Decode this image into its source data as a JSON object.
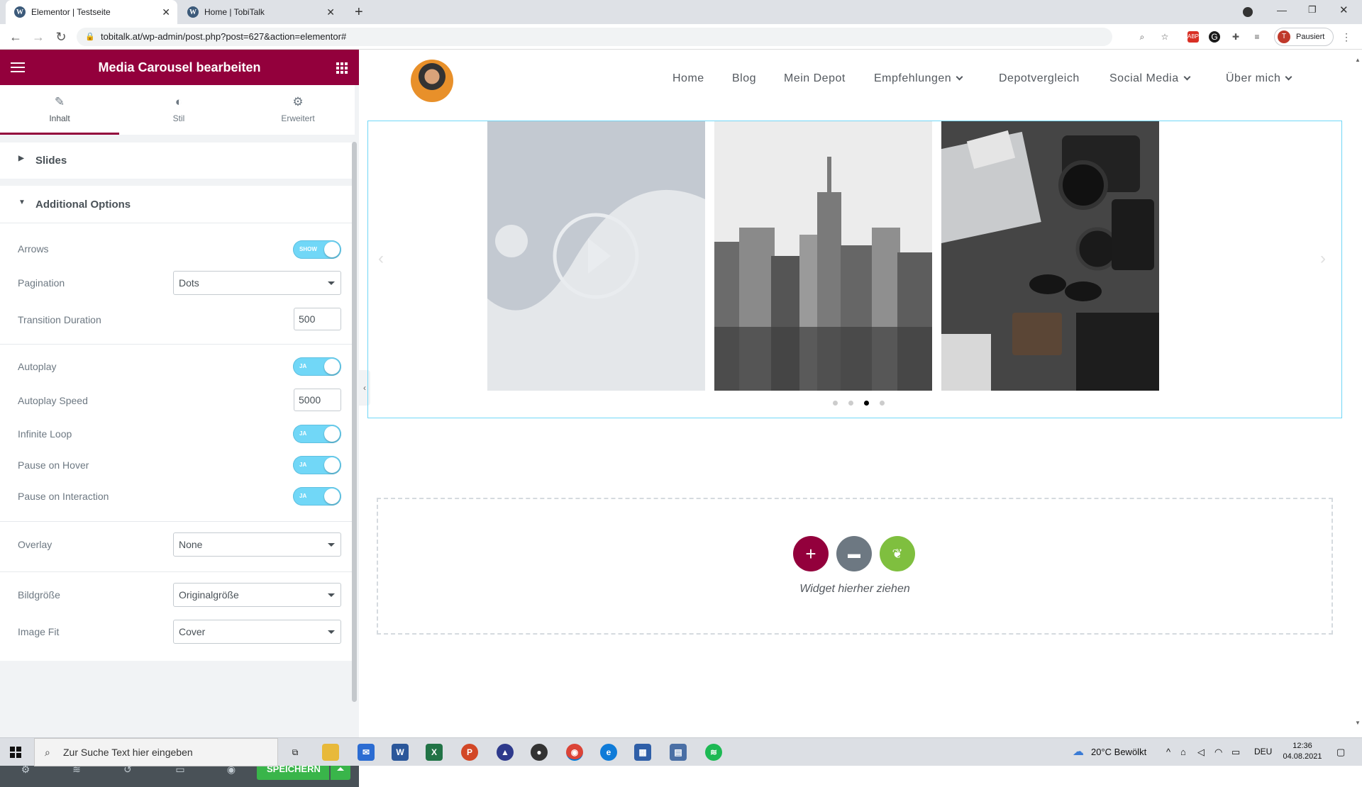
{
  "browser": {
    "tabs": [
      {
        "label": "Elementor | Testseite",
        "icon": "wordpress-icon"
      },
      {
        "label": "Home | TobiTalk",
        "icon": "wordpress-icon"
      }
    ],
    "url": "tobitalk.at/wp-admin/post.php?post=627&action=elementor#",
    "profile_label": "Pausiert",
    "profile_initial": "T"
  },
  "panel": {
    "title": "Media Carousel bearbeiten",
    "tabs": [
      {
        "label": "Inhalt",
        "icon": "pencil-icon"
      },
      {
        "label": "Stil",
        "icon": "contrast-icon"
      },
      {
        "label": "Erweitert",
        "icon": "gear-icon"
      }
    ],
    "sections": {
      "slides": "Slides",
      "additional": "Additional Options"
    },
    "controls": {
      "arrows": {
        "label": "Arrows",
        "toggle_text": "SHOW",
        "on": true
      },
      "pagination": {
        "label": "Pagination",
        "value": "Dots"
      },
      "transition": {
        "label": "Transition Duration",
        "value": "500"
      },
      "autoplay": {
        "label": "Autoplay",
        "toggle_text": "JA",
        "on": true
      },
      "autoplay_speed": {
        "label": "Autoplay Speed",
        "value": "5000"
      },
      "infinite_loop": {
        "label": "Infinite Loop",
        "toggle_text": "JA",
        "on": true
      },
      "pause_hover": {
        "label": "Pause on Hover",
        "toggle_text": "JA",
        "on": true
      },
      "pause_interaction": {
        "label": "Pause on Interaction",
        "toggle_text": "JA",
        "on": true
      },
      "overlay": {
        "label": "Overlay",
        "value": "None"
      },
      "image_size": {
        "label": "Bildgröße",
        "value": "Originalgröße"
      },
      "image_fit": {
        "label": "Image Fit",
        "value": "Cover"
      }
    },
    "save_label": "SPEICHERN"
  },
  "site": {
    "menu": [
      {
        "label": "Home",
        "has_dropdown": false
      },
      {
        "label": "Blog",
        "has_dropdown": false
      },
      {
        "label": "Mein Depot",
        "has_dropdown": false
      },
      {
        "label": "Empfehlungen",
        "has_dropdown": true
      },
      {
        "label": "Depotvergleich",
        "has_dropdown": false
      },
      {
        "label": "Social Media",
        "has_dropdown": true
      },
      {
        "label": "Über mich",
        "has_dropdown": true
      }
    ],
    "carousel": {
      "slides": [
        "video-placeholder",
        "city-skyline",
        "camera-desk"
      ],
      "dots_count": 4,
      "active_dot": 3
    },
    "dropzone_label": "Widget hierher ziehen"
  },
  "taskbar": {
    "search_placeholder": "Zur Suche Text hier eingeben",
    "weather": "20°C Bewölkt",
    "language": "DEU",
    "time": "12:36",
    "date": "04.08.2021"
  },
  "colors": {
    "brand": "#93003c",
    "toggle_on": "#71d7f7",
    "save": "#39b54a",
    "widget_green": "#7fbf3f"
  }
}
